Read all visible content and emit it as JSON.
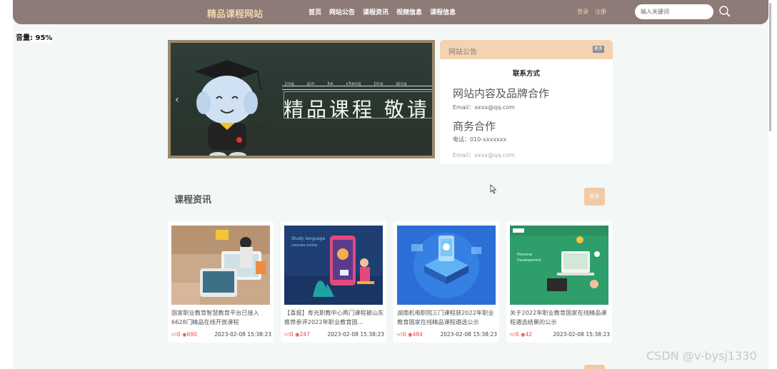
{
  "header": {
    "brand": "精品课程网站",
    "nav": [
      "首页",
      "网站公告",
      "课程资讯",
      "视频信息",
      "课程信息"
    ],
    "login": "登录",
    "register": "注册",
    "search_placeholder": "输入关键词"
  },
  "overlay": {
    "volume": "音量: 95%"
  },
  "banner": {
    "pinyin": [
      "jing",
      "pin",
      "ke",
      "cheng",
      "jing",
      "qing"
    ],
    "title": "精品课程 敬请"
  },
  "notice": {
    "header": "网站公告",
    "more": "更多",
    "subtitle": "联系方式",
    "heading1": "网站内容及品牌合作",
    "line1": "Email：xxxx@qq.com",
    "heading2": "商务合作",
    "line2": "电话：010-xxxxxxx",
    "line3": "Email：xxxx@qq.com"
  },
  "news": {
    "title": "课程资讯",
    "more": "更多",
    "cards": [
      {
        "title": "国家职业教育智慧教育平台已接入6628门精品在线开放课程",
        "likes": "0",
        "views": "690",
        "date": "2023-02-08 15:38:23"
      },
      {
        "title": "【喜报】寿光职教中心两门课程被山东推荐参评2022年职业教育国...",
        "likes": "0",
        "views": "247",
        "date": "2023-02-08 15:38:23"
      },
      {
        "title": "湖南机电职院三门课程获2022年职业教育国家在线精品课程遴选公示",
        "likes": "0",
        "views": "484",
        "date": "2023-02-08 15:38:23"
      },
      {
        "title": "关于2022年职业教育国家在线精品课程遴选结果的公示",
        "likes": "0",
        "views": "42",
        "date": "2023-02-08 15:38:23"
      }
    ]
  },
  "watermark": "CSDN @v-bysj1330",
  "colors": {
    "header_bg": "#8d7b78",
    "accent": "#f0caa5",
    "brand_text": "#f0d3ad"
  }
}
